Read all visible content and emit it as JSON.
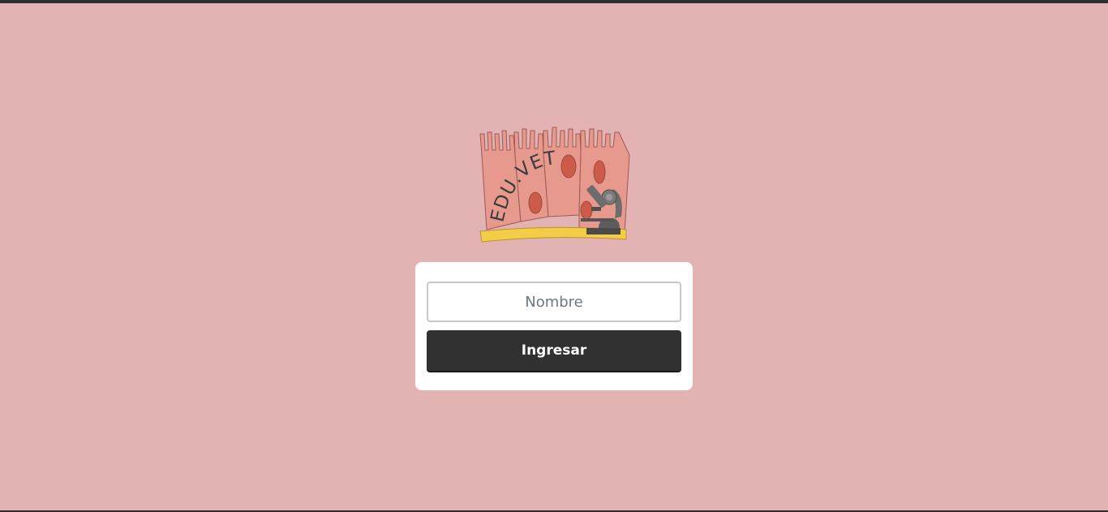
{
  "logo": {
    "text": "EDU.VET",
    "icon": "microscope-icon"
  },
  "login": {
    "name_placeholder": "Nombre",
    "name_value": "",
    "submit_label": "Ingresar"
  },
  "colors": {
    "background": "#e3b2b2",
    "card": "#ffffff",
    "button": "#313131",
    "cell_fill": "#e8998d",
    "nucleus": "#cc5b49",
    "base_band": "#f3cd48"
  }
}
